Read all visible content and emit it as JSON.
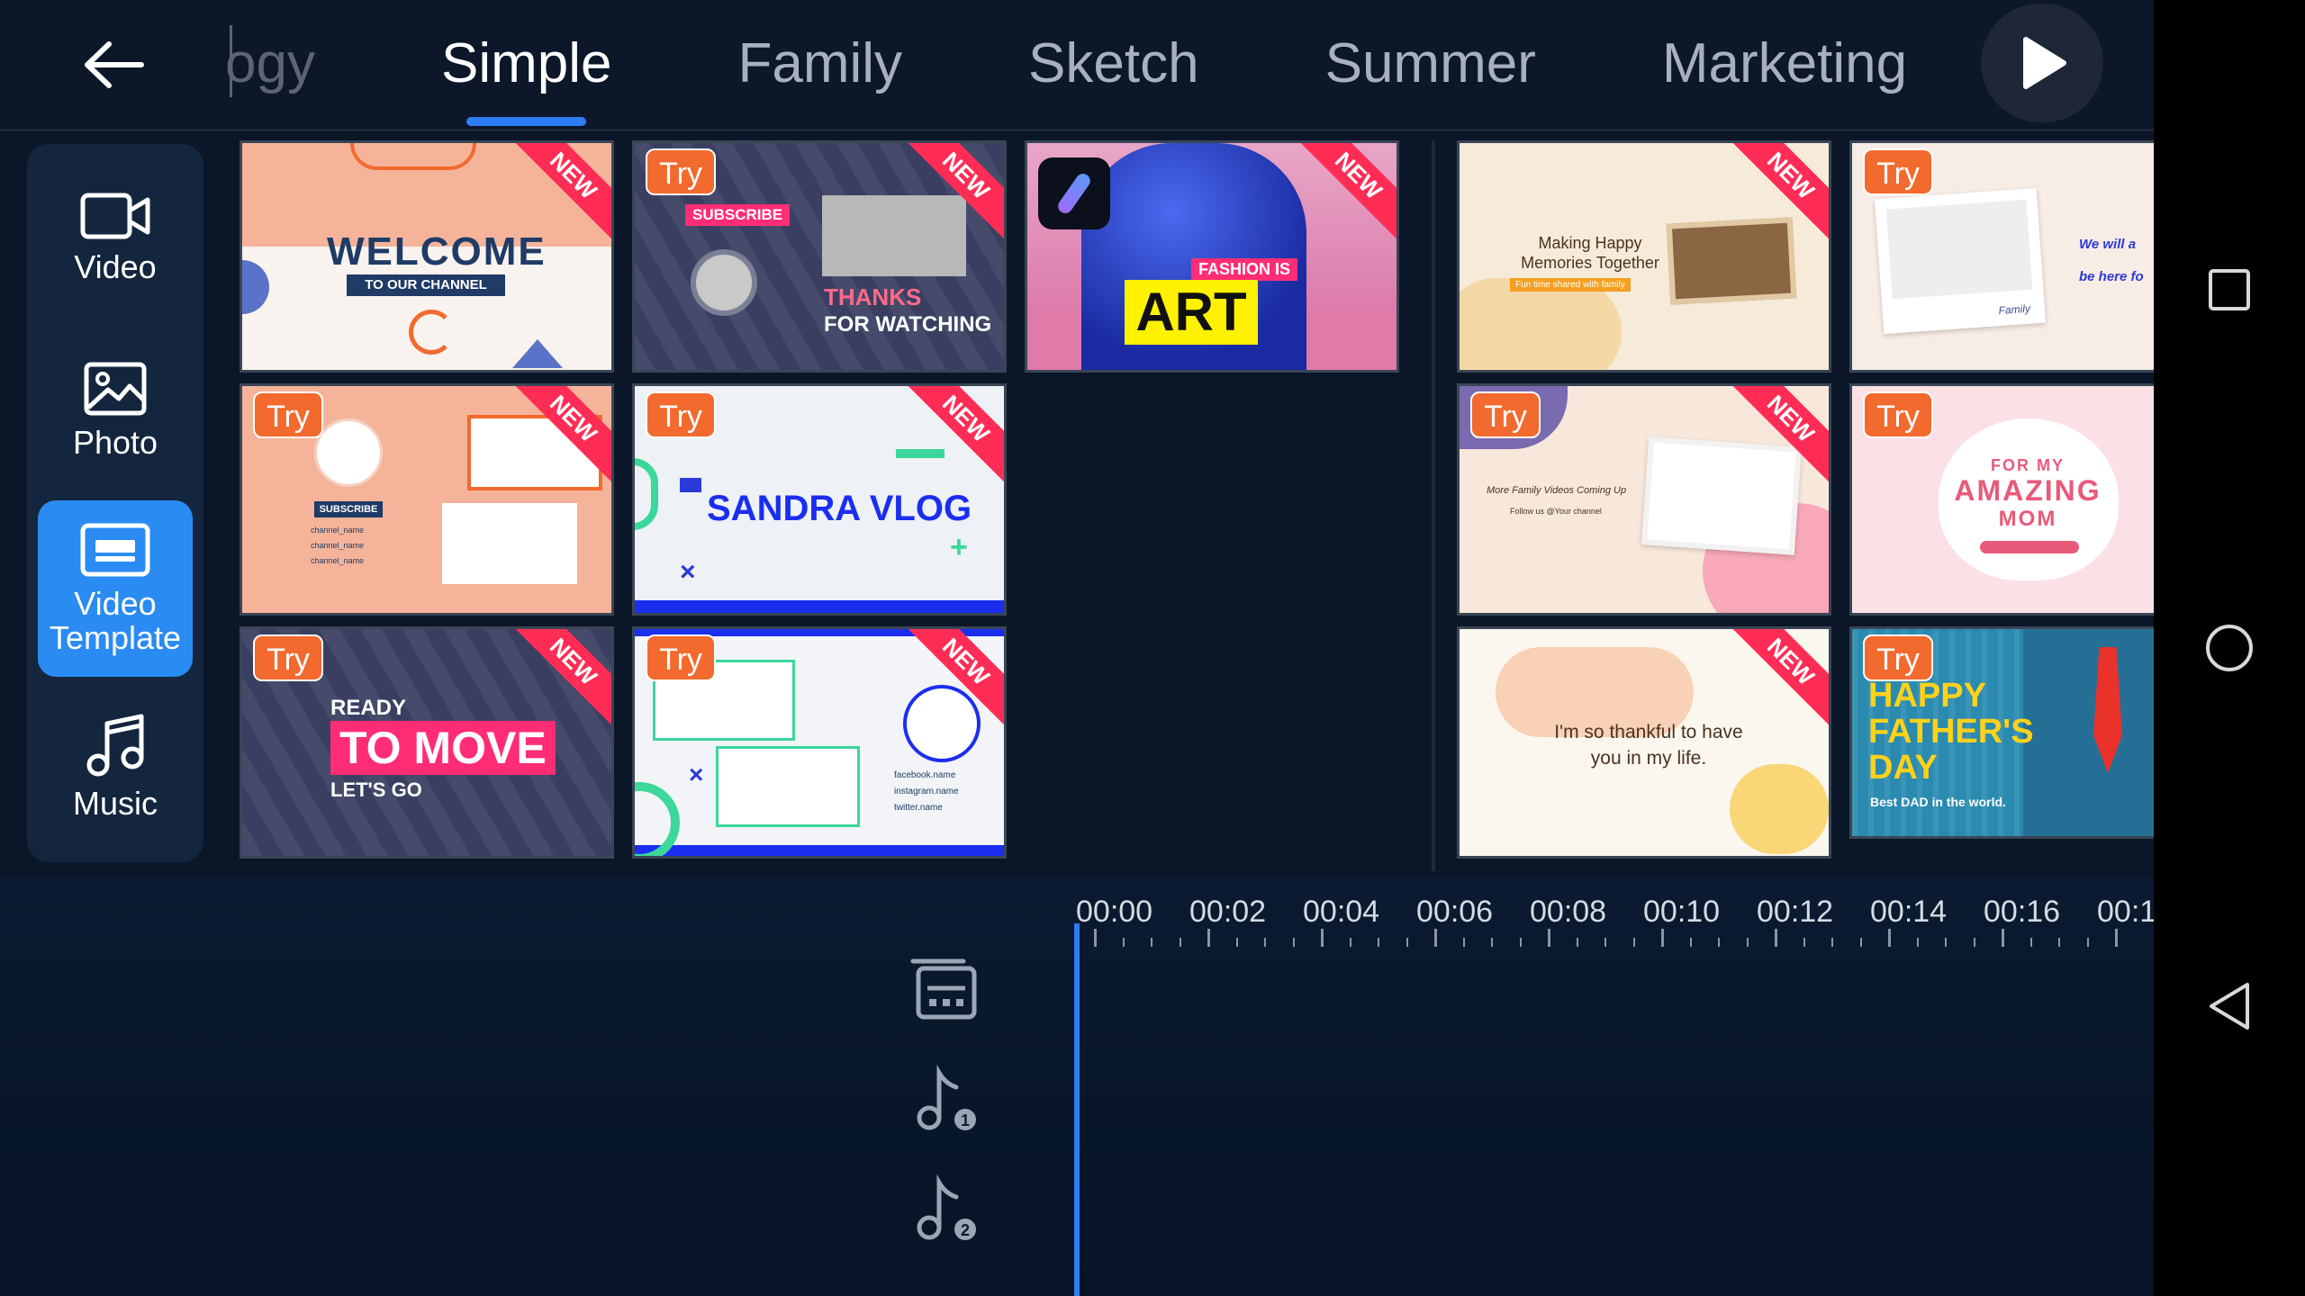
{
  "tabs": [
    {
      "label": "ogy"
    },
    {
      "label": "Simple"
    },
    {
      "label": "Family"
    },
    {
      "label": "Sketch"
    },
    {
      "label": "Summer"
    },
    {
      "label": "Marketing"
    }
  ],
  "sidenav": {
    "video": "Video",
    "photo": "Photo",
    "template": "Video Template",
    "music": "Music"
  },
  "badges": {
    "new": "NEW",
    "try": "Try"
  },
  "cards": {
    "welcome_title": "WELCOME",
    "welcome_sub": "TO OUR CHANNEL",
    "subscribe": "SUBSCRIBE",
    "thanks": "THANKS",
    "for_watching": "FOR WATCHING",
    "fashion_is": "FASHION IS",
    "art": "ART",
    "making_happy": "Making Happy Memories Together",
    "fun_time": "Fun time shared with family",
    "we_will": "We will a",
    "be_here": "be here fo",
    "family_sig": "Family",
    "sub_small": "SUBSCRIBE",
    "channel_name": "channel_name",
    "sandra": "SANDRA VLOG",
    "more_family": "More Family Videos Coming Up",
    "follow_us": "Follow us @Your channel",
    "for_my": "FOR MY",
    "amazing": "AMAZING",
    "mom": "MOM",
    "ready": "READY",
    "to_move": "TO MOVE",
    "lets_go": "LET'S GO",
    "facebook": "facebook.name",
    "instagram": "instagram.name",
    "twitter": "twitter.name",
    "thankful": "I'm so thankful to have you in my life.",
    "happy": "HAPPY",
    "fathers": "FATHER'S",
    "day": "DAY",
    "best_dad": "Best DAD in the world."
  },
  "timeline": {
    "ticks": [
      "00:00",
      "00:02",
      "00:04",
      "00:06",
      "00:08",
      "00:10",
      "00:12",
      "00:14",
      "00:16",
      "00:1"
    ],
    "track1_badge": "1",
    "track2_badge": "2"
  },
  "colors": {
    "accent": "#2f7df4",
    "new_ribbon": "#ff2d55",
    "try_badge": "#f26a2e",
    "background": "#0b1628"
  }
}
